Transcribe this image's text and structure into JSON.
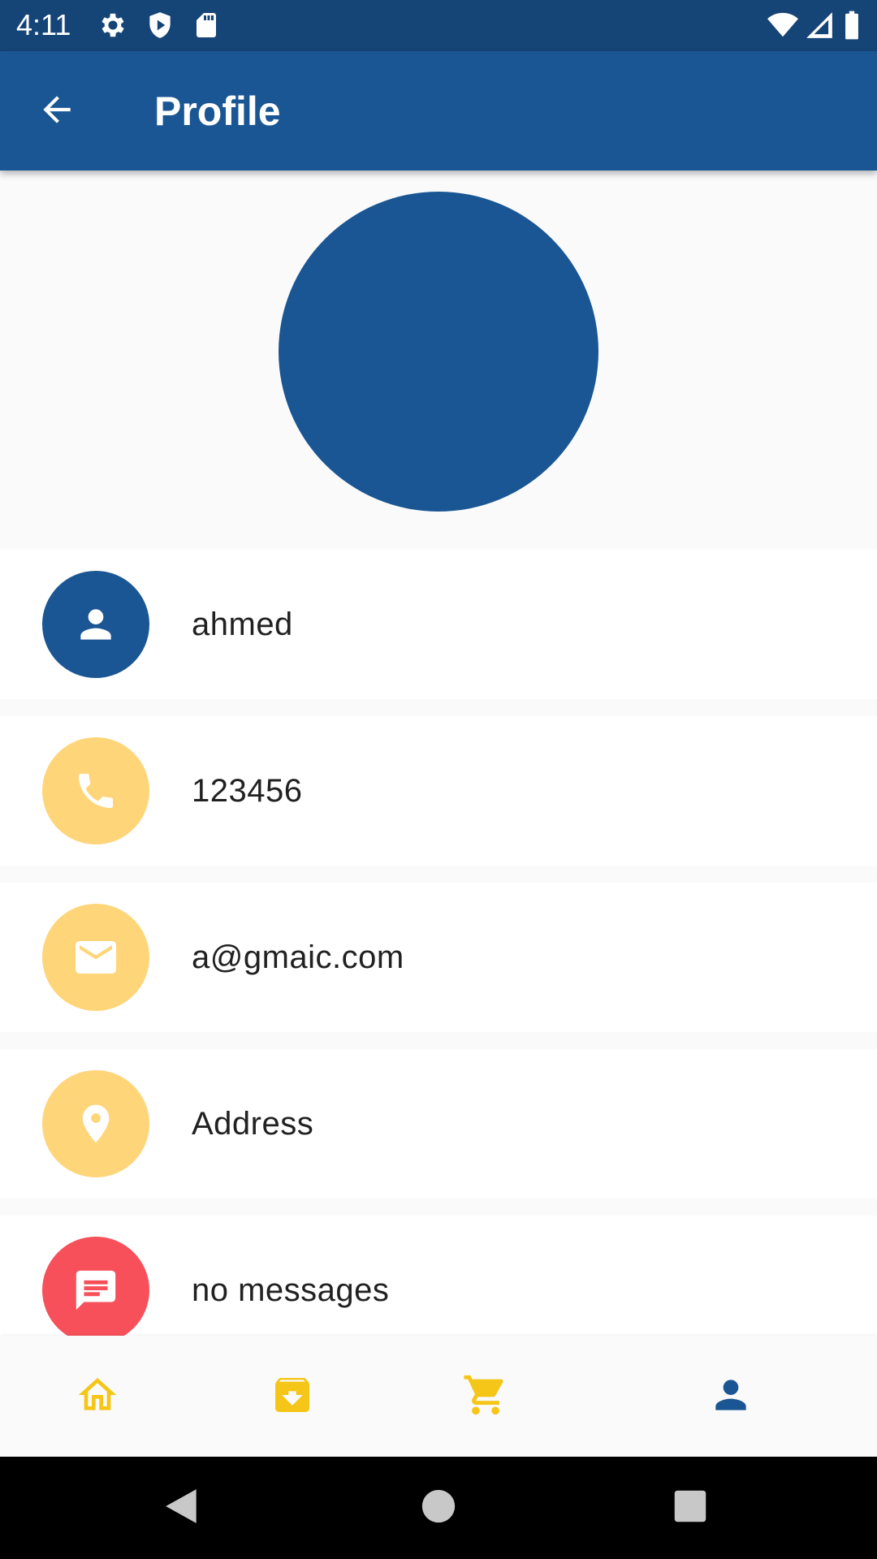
{
  "status_bar": {
    "time": "4:11",
    "icons_left": [
      "gear-icon",
      "shield-play-icon",
      "sd-card-icon"
    ],
    "icons_right": [
      "wifi-icon",
      "signal-icon",
      "battery-icon"
    ]
  },
  "app_bar": {
    "title": "Profile",
    "back_icon": "arrow-back-icon"
  },
  "colors": {
    "primary": "#1a5694",
    "primary_dark": "#154476",
    "accent_yellow": "#ffd57a",
    "accent_red": "#f7505a",
    "nav_yellow": "#f5c518"
  },
  "profile": {
    "rows": [
      {
        "icon": "person-icon",
        "value": "ahmed"
      },
      {
        "icon": "phone-icon",
        "value": "123456"
      },
      {
        "icon": "mail-icon",
        "value": "a@gmaic.com"
      },
      {
        "icon": "location-pin-icon",
        "value": "Address"
      },
      {
        "icon": "chat-message-icon",
        "value": "no messages"
      }
    ]
  },
  "bottom_nav": {
    "items": [
      {
        "icon": "home-icon",
        "selected": false
      },
      {
        "icon": "archive-download-icon",
        "selected": false
      },
      {
        "icon": "cart-icon",
        "selected": false
      },
      {
        "icon": "person-icon",
        "selected": true
      }
    ]
  },
  "system_nav": {
    "items": [
      "back-triangle-icon",
      "home-circle-icon",
      "recents-square-icon"
    ]
  }
}
